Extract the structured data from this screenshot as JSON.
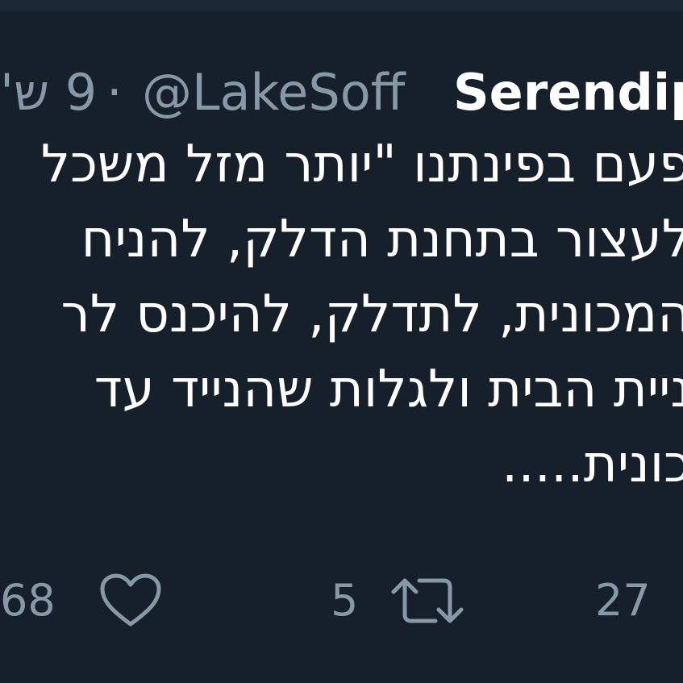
{
  "tweet": {
    "author_name": "Serendip",
    "handle": "@LakeSoff",
    "separator": "·",
    "time": "9 ש'",
    "body_lines": [
      "פעם בפינתנו \"יותר מזל משכל",
      "לעצור בתחנת הדלק, להניח",
      "המכונית, לתדלק, להיכנס לר",
      "ניית הבית ולגלות שהנייד עד",
      "כונית....."
    ]
  },
  "actions": {
    "likes_count": "68",
    "retweets_count": "5",
    "replies_count": "27"
  },
  "colors": {
    "background": "#15202b",
    "secondary_text": "#8899a6",
    "primary_text": "#ffffff"
  }
}
